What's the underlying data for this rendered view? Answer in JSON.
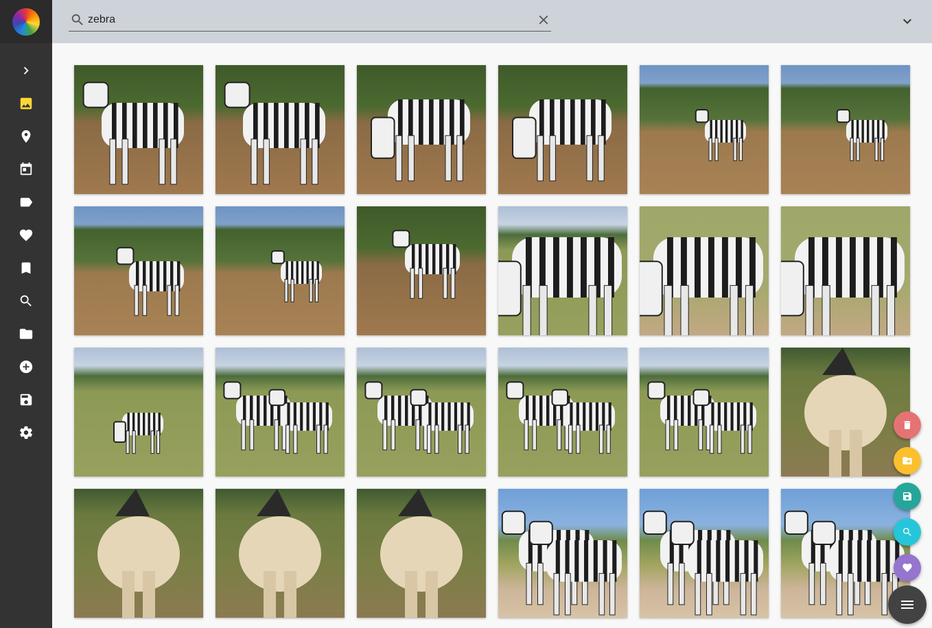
{
  "search": {
    "value": "zebra",
    "placeholder": "Search"
  },
  "sidebar": {
    "items": [
      {
        "name": "expand",
        "icon": "chevron-right-icon",
        "active": false
      },
      {
        "name": "photos",
        "icon": "image-icon",
        "active": true
      },
      {
        "name": "places",
        "icon": "map-pin-icon",
        "active": false
      },
      {
        "name": "calendar",
        "icon": "calendar-icon",
        "active": false
      },
      {
        "name": "labels",
        "icon": "label-icon",
        "active": false
      },
      {
        "name": "favorites",
        "icon": "heart-icon",
        "active": false
      },
      {
        "name": "albums",
        "icon": "bookmark-icon",
        "active": false
      },
      {
        "name": "search",
        "icon": "search-icon",
        "active": false
      },
      {
        "name": "folders",
        "icon": "folder-icon",
        "active": false
      },
      {
        "name": "import",
        "icon": "add-circle-icon",
        "active": false
      },
      {
        "name": "saved",
        "icon": "save-icon",
        "active": false
      },
      {
        "name": "settings",
        "icon": "gear-icon",
        "active": false
      }
    ]
  },
  "photos": [
    {
      "scene": "bush",
      "pose": "stand-close"
    },
    {
      "scene": "bush",
      "pose": "stand-close"
    },
    {
      "scene": "bush",
      "pose": "graze-close"
    },
    {
      "scene": "bush",
      "pose": "graze-close"
    },
    {
      "scene": "bush-sky",
      "pose": "stand-far"
    },
    {
      "scene": "bush-sky",
      "pose": "stand-far"
    },
    {
      "scene": "bush-sky",
      "pose": "stand-mid"
    },
    {
      "scene": "bush-sky",
      "pose": "stand-far"
    },
    {
      "scene": "bush",
      "pose": "stand-front"
    },
    {
      "scene": "grass-sky",
      "pose": "graze-big"
    },
    {
      "scene": "grass",
      "pose": "graze-big"
    },
    {
      "scene": "grass",
      "pose": "graze-big"
    },
    {
      "scene": "grass-sky",
      "pose": "graze-far"
    },
    {
      "scene": "grass-sky",
      "pose": "pair"
    },
    {
      "scene": "grass-sky",
      "pose": "pair"
    },
    {
      "scene": "grass-sky",
      "pose": "pair"
    },
    {
      "scene": "grass-sky",
      "pose": "pair"
    },
    {
      "scene": "grass-dark",
      "pose": "rear"
    },
    {
      "scene": "grass-dark",
      "pose": "rear"
    },
    {
      "scene": "grass-dark",
      "pose": "rear"
    },
    {
      "scene": "grass-dark",
      "pose": "rear"
    },
    {
      "scene": "road-sky",
      "pose": "pair-side"
    },
    {
      "scene": "road-sky",
      "pose": "pair-side"
    },
    {
      "scene": "road-sky",
      "pose": "pair-side"
    }
  ],
  "actions": [
    {
      "name": "delete",
      "icon": "trash-icon",
      "color": "#e57373"
    },
    {
      "name": "move-to-folder",
      "icon": "folder-add-icon",
      "color": "#fbc02d"
    },
    {
      "name": "save",
      "icon": "save-icon",
      "color": "#26a69a"
    },
    {
      "name": "search-similar",
      "icon": "zoom-icon",
      "color": "#26c6da"
    },
    {
      "name": "favorite",
      "icon": "heart-icon",
      "color": "#9575cd"
    }
  ],
  "colors": {
    "sidebar": "#333333",
    "topbar": "#cdd3d9",
    "active_nav": "#fdd835",
    "menu_fab": "#424242"
  }
}
